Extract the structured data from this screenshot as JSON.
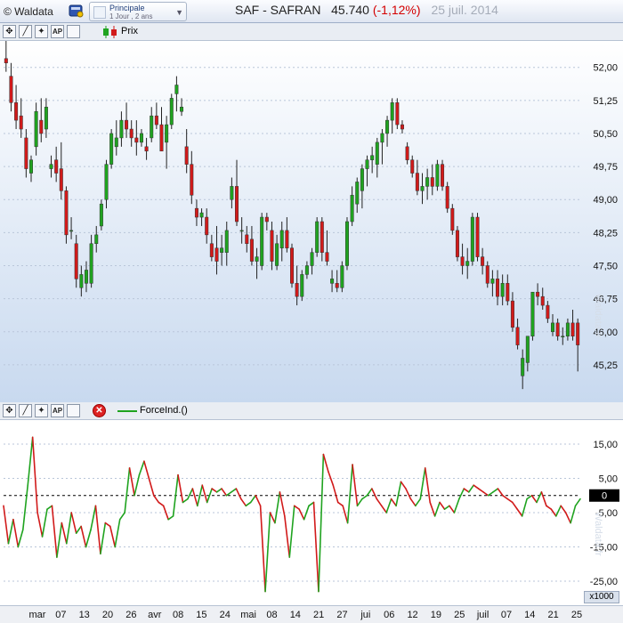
{
  "app": {
    "brand": "© Waldata"
  },
  "period": {
    "main": "Principale",
    "sub": "1 Jour , 2 ans"
  },
  "header": {
    "symbol": "SAF - SAFRAN",
    "price": "45.740",
    "change": "(-1,12%)",
    "date": "25 juil. 2014"
  },
  "toolbar": {
    "tools": [
      "crosshair-tool",
      "draw-line-tool",
      "ap-tool",
      "box-tool"
    ],
    "ap_label": "AP"
  },
  "panels": {
    "price_legend": "Prix",
    "indicator_legend": "ForceInd.()",
    "unit_label": "x1000",
    "watermark": "Waldata.fr"
  },
  "colors": {
    "up": "#1fa31f",
    "down": "#d11a1a",
    "grid": "#b9c6d9",
    "zero_line": "#000000"
  },
  "x_axis": {
    "labels": [
      "mar",
      "07",
      "13",
      "20",
      "26",
      "avr",
      "08",
      "15",
      "24",
      "mai",
      "08",
      "14",
      "21",
      "27",
      "jui",
      "06",
      "12",
      "19",
      "25",
      "juil",
      "07",
      "14",
      "21",
      "25"
    ]
  },
  "chart_data": [
    {
      "type": "candlestick",
      "title": "Prix",
      "ylim": [
        44.4,
        52.6
      ],
      "y_ticks": [
        "52,00",
        "51,25",
        "50,50",
        "49,75",
        "49,00",
        "48,25",
        "47,50",
        "46,75",
        "46,00",
        "45,25"
      ],
      "grid": true,
      "ohlc": [
        [
          52.2,
          52.8,
          51.9,
          52.1
        ],
        [
          51.8,
          52.1,
          51.0,
          51.2
        ],
        [
          51.2,
          51.6,
          50.6,
          50.8
        ],
        [
          50.9,
          51.3,
          50.4,
          50.6
        ],
        [
          50.4,
          50.6,
          49.5,
          49.7
        ],
        [
          49.6,
          50.0,
          49.4,
          49.9
        ],
        [
          50.2,
          51.2,
          50.0,
          51.0
        ],
        [
          50.8,
          51.3,
          50.3,
          50.5
        ],
        [
          50.6,
          51.3,
          50.4,
          51.1
        ],
        [
          49.7,
          50.0,
          49.5,
          49.8
        ],
        [
          49.9,
          50.2,
          49.4,
          49.6
        ],
        [
          49.7,
          50.3,
          49.0,
          49.2
        ],
        [
          49.2,
          49.3,
          48.0,
          48.2
        ],
        [
          48.3,
          48.6,
          48.1,
          48.3
        ],
        [
          48.0,
          48.2,
          47.0,
          47.2
        ],
        [
          47.0,
          47.5,
          46.8,
          47.3
        ],
        [
          47.1,
          47.6,
          46.9,
          47.4
        ],
        [
          47.1,
          48.2,
          47.0,
          48.0
        ],
        [
          48.0,
          48.4,
          47.8,
          48.2
        ],
        [
          48.4,
          49.0,
          48.3,
          48.9
        ],
        [
          49.0,
          49.9,
          48.8,
          49.8
        ],
        [
          49.8,
          50.6,
          49.7,
          50.5
        ],
        [
          50.2,
          50.8,
          50.0,
          50.4
        ],
        [
          50.4,
          51.0,
          50.2,
          50.8
        ],
        [
          50.8,
          51.2,
          50.4,
          50.6
        ],
        [
          50.6,
          50.8,
          50.2,
          50.4
        ],
        [
          50.4,
          50.8,
          50.0,
          50.3
        ],
        [
          50.3,
          50.6,
          50.2,
          50.5
        ],
        [
          50.2,
          50.4,
          49.9,
          50.1
        ],
        [
          50.4,
          51.1,
          50.3,
          50.9
        ],
        [
          50.9,
          51.2,
          50.6,
          50.7
        ],
        [
          50.7,
          51.1,
          50.3,
          50.1
        ],
        [
          50.3,
          50.9,
          49.7,
          50.7
        ],
        [
          50.7,
          51.4,
          50.6,
          51.3
        ],
        [
          51.4,
          51.8,
          51.0,
          51.6
        ],
        [
          51.0,
          51.3,
          50.9,
          51.1
        ],
        [
          50.2,
          50.6,
          49.6,
          49.8
        ],
        [
          49.8,
          50.1,
          48.9,
          49.1
        ],
        [
          48.8,
          49.0,
          48.4,
          48.6
        ],
        [
          48.6,
          48.8,
          48.4,
          48.7
        ],
        [
          48.6,
          48.8,
          48.0,
          48.2
        ],
        [
          48.0,
          48.2,
          47.6,
          47.7
        ],
        [
          47.9,
          48.4,
          47.3,
          47.6
        ],
        [
          47.8,
          48.2,
          47.5,
          47.9
        ],
        [
          47.8,
          48.5,
          47.5,
          48.3
        ],
        [
          49.0,
          49.5,
          48.8,
          49.3
        ],
        [
          49.3,
          49.9,
          48.4,
          48.5
        ],
        [
          48.3,
          48.6,
          48.0,
          48.3
        ],
        [
          48.2,
          48.4,
          47.8,
          48.0
        ],
        [
          48.1,
          48.4,
          47.5,
          47.6
        ],
        [
          47.6,
          47.9,
          47.2,
          47.7
        ],
        [
          47.5,
          48.7,
          47.4,
          48.6
        ],
        [
          48.6,
          48.7,
          48.3,
          48.5
        ],
        [
          48.3,
          48.5,
          47.4,
          47.6
        ],
        [
          47.5,
          48.2,
          47.4,
          48.0
        ],
        [
          47.9,
          48.5,
          47.6,
          48.3
        ],
        [
          48.3,
          48.6,
          47.8,
          47.9
        ],
        [
          47.9,
          48.0,
          47.0,
          47.1
        ],
        [
          47.1,
          47.5,
          46.6,
          46.8
        ],
        [
          46.8,
          47.4,
          46.7,
          47.3
        ],
        [
          47.3,
          47.6,
          47.2,
          47.5
        ],
        [
          47.5,
          47.9,
          47.3,
          47.8
        ],
        [
          47.8,
          48.6,
          47.7,
          48.5
        ],
        [
          48.5,
          48.6,
          47.6,
          47.8
        ],
        [
          47.8,
          48.3,
          47.5,
          47.6
        ],
        [
          47.1,
          47.4,
          46.9,
          47.2
        ],
        [
          47.1,
          47.4,
          46.9,
          47.0
        ],
        [
          47.0,
          47.6,
          46.9,
          47.5
        ],
        [
          47.5,
          48.6,
          47.4,
          48.5
        ],
        [
          48.5,
          49.3,
          48.4,
          49.1
        ],
        [
          48.9,
          49.5,
          48.7,
          49.4
        ],
        [
          49.2,
          49.8,
          48.8,
          49.7
        ],
        [
          49.7,
          50.0,
          49.3,
          49.9
        ],
        [
          49.9,
          50.2,
          49.6,
          50.0
        ],
        [
          49.8,
          50.4,
          49.5,
          50.3
        ],
        [
          50.3,
          50.6,
          49.8,
          50.5
        ],
        [
          50.5,
          50.9,
          50.2,
          50.8
        ],
        [
          50.8,
          51.3,
          50.5,
          51.2
        ],
        [
          51.2,
          51.3,
          50.6,
          50.7
        ],
        [
          50.7,
          50.8,
          50.5,
          50.6
        ],
        [
          50.2,
          50.3,
          49.8,
          49.9
        ],
        [
          49.9,
          50.0,
          49.5,
          49.6
        ],
        [
          49.6,
          49.9,
          49.1,
          49.2
        ],
        [
          49.2,
          49.6,
          48.9,
          49.3
        ],
        [
          49.3,
          49.7,
          49.0,
          49.5
        ],
        [
          49.5,
          49.8,
          49.1,
          49.3
        ],
        [
          49.3,
          49.9,
          49.2,
          49.8
        ],
        [
          49.8,
          49.9,
          49.2,
          49.3
        ],
        [
          49.3,
          49.4,
          48.7,
          48.8
        ],
        [
          48.8,
          48.9,
          48.2,
          48.3
        ],
        [
          48.3,
          48.4,
          47.6,
          47.7
        ],
        [
          47.7,
          48.0,
          47.3,
          47.5
        ],
        [
          47.5,
          47.9,
          47.2,
          47.6
        ],
        [
          47.6,
          48.7,
          47.5,
          48.6
        ],
        [
          48.6,
          48.7,
          47.6,
          47.7
        ],
        [
          47.7,
          47.9,
          47.3,
          47.5
        ],
        [
          47.5,
          47.6,
          47.0,
          47.1
        ],
        [
          47.1,
          47.4,
          46.8,
          47.2
        ],
        [
          47.2,
          47.4,
          46.6,
          46.8
        ],
        [
          46.8,
          47.3,
          46.6,
          47.1
        ],
        [
          47.1,
          47.3,
          46.6,
          46.7
        ],
        [
          46.7,
          46.9,
          46.0,
          46.1
        ],
        [
          46.1,
          46.3,
          45.6,
          45.7
        ],
        [
          45.0,
          45.6,
          44.7,
          45.4
        ],
        [
          45.3,
          45.9,
          45.1,
          45.9
        ],
        [
          45.9,
          46.9,
          45.8,
          46.9
        ],
        [
          46.9,
          47.1,
          46.6,
          46.8
        ],
        [
          46.8,
          47.0,
          46.5,
          46.6
        ],
        [
          46.6,
          46.7,
          46.2,
          46.3
        ],
        [
          46.0,
          46.4,
          45.9,
          46.2
        ],
        [
          46.2,
          46.3,
          45.8,
          45.9
        ],
        [
          45.9,
          46.1,
          45.7,
          45.9
        ],
        [
          45.9,
          46.3,
          45.8,
          46.2
        ],
        [
          46.2,
          46.5,
          45.8,
          45.9
        ],
        [
          46.2,
          46.3,
          45.1,
          45.7
        ]
      ]
    },
    {
      "type": "line",
      "title": "ForceInd.()",
      "ylim": [
        -32,
        22
      ],
      "y_ticks": [
        15,
        5,
        0,
        -5,
        -15,
        -25
      ],
      "reference_line": 0,
      "values": [
        -3,
        -14,
        -7,
        -15,
        -10,
        3,
        17,
        -5,
        -12,
        -4,
        -3,
        -18,
        -8,
        -14,
        -5,
        -11,
        -9,
        -15,
        -10,
        -3,
        -17,
        -8,
        -9,
        -15,
        -7,
        -5,
        8,
        0,
        6,
        10,
        5,
        0,
        -2,
        -3,
        -7,
        -6,
        6,
        -2,
        -1,
        2,
        -3,
        3,
        -2,
        2,
        1,
        2,
        0,
        1,
        2,
        -1,
        -3,
        -2,
        0,
        -3,
        -28,
        -5,
        -8,
        1,
        -6,
        -18,
        -3,
        -4,
        -7,
        -3,
        -2,
        -28,
        12,
        7,
        3,
        -2,
        -3,
        -8,
        9,
        -3,
        -1,
        0,
        2,
        -1,
        -3,
        -5,
        -1,
        -3,
        4,
        2,
        -1,
        -3,
        -1,
        8,
        -2,
        -6,
        -2,
        -4,
        -3,
        -5,
        -1,
        2,
        1,
        3,
        2,
        1,
        0,
        1,
        2,
        0,
        -1,
        -2,
        -4,
        -6,
        -1,
        0,
        -2,
        1,
        -3,
        -4,
        -6,
        -3,
        -5,
        -8,
        -3,
        -1
      ]
    }
  ]
}
